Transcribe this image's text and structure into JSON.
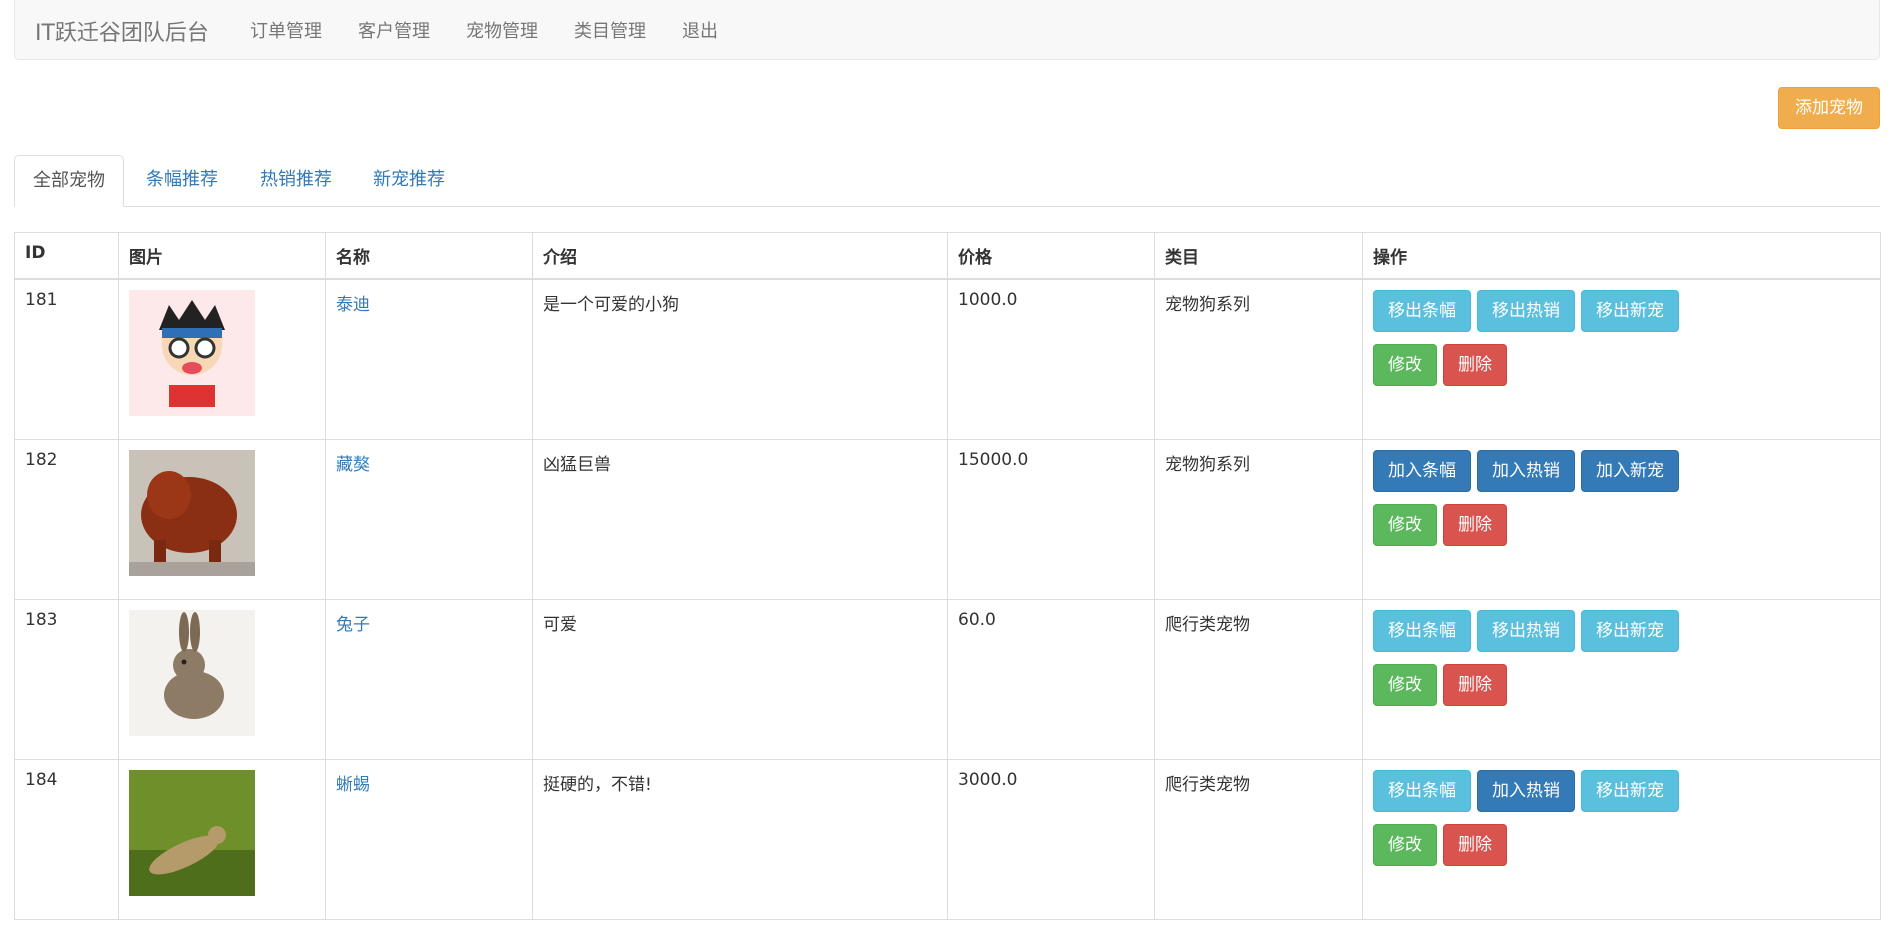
{
  "navbar": {
    "brand": "IT跃迁谷团队后台",
    "items": [
      "订单管理",
      "客户管理",
      "宠物管理",
      "类目管理",
      "退出"
    ]
  },
  "add_button": "添加宠物",
  "tabs": [
    "全部宠物",
    "条幅推荐",
    "热销推荐",
    "新宠推荐"
  ],
  "table": {
    "headers": [
      "ID",
      "图片",
      "名称",
      "介绍",
      "价格",
      "类目",
      "操作"
    ],
    "rows": [
      {
        "id": "181",
        "name": "泰迪",
        "intro": "是一个可爱的小狗",
        "price": "1000.0",
        "category": "宠物狗系列",
        "actions": [
          "移出条幅",
          "移出热销",
          "移出新宠"
        ],
        "action_styles": [
          "info",
          "info",
          "info"
        ]
      },
      {
        "id": "182",
        "name": "藏獒",
        "intro": "凶猛巨兽",
        "price": "15000.0",
        "category": "宠物狗系列",
        "actions": [
          "加入条幅",
          "加入热销",
          "加入新宠"
        ],
        "action_styles": [
          "primary",
          "primary",
          "primary"
        ]
      },
      {
        "id": "183",
        "name": "兔子",
        "intro": "可爱",
        "price": "60.0",
        "category": "爬行类宠物",
        "actions": [
          "移出条幅",
          "移出热销",
          "移出新宠"
        ],
        "action_styles": [
          "info",
          "info",
          "info"
        ]
      },
      {
        "id": "184",
        "name": "蜥蜴",
        "intro": "挺硬的，不错!",
        "price": "3000.0",
        "category": "爬行类宠物",
        "actions": [
          "移出条幅",
          "加入热销",
          "移出新宠"
        ],
        "action_styles": [
          "info",
          "primary",
          "info"
        ]
      }
    ],
    "edit_label": "修改",
    "delete_label": "删除"
  },
  "colors": {
    "warning": "#f0ad4e",
    "info": "#5bc0de",
    "primary": "#337ab7",
    "success": "#5cb85c",
    "danger": "#d9534f"
  }
}
